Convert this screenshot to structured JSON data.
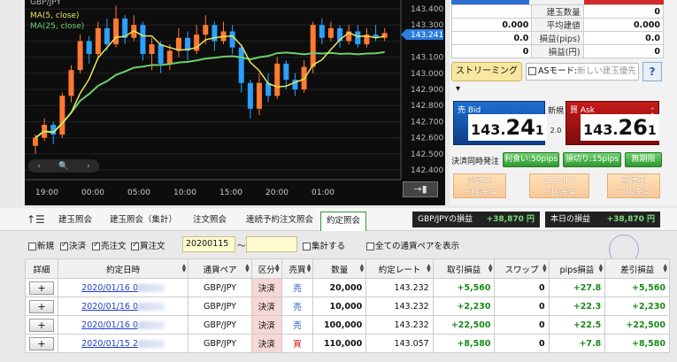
{
  "chart": {
    "title": "GBP/JPY",
    "legend": [
      "MA(5, close)",
      "MA(25, close)"
    ],
    "colors": {
      "up": "#ff7a30",
      "down": "#2aa0ff",
      "ma5": "#e6e65a",
      "ma25": "#6cd06c",
      "current": "#2a7de0"
    },
    "price_ticks": [
      "143.400",
      "143.300",
      "143.241",
      "143.100",
      "143.000",
      "142.900",
      "142.800",
      "142.700",
      "142.600",
      "142.500",
      "142.400"
    ],
    "time_ticks": [
      "19:00",
      "00:00",
      "05:00",
      "10:00",
      "15:00",
      "20:00",
      "01:00"
    ],
    "current_price": "143.241",
    "zoom_controls": [
      "‹",
      "🔍",
      "›"
    ],
    "jump_label": "→▮"
  },
  "position": {
    "rows": [
      {
        "left": "",
        "label": "建玉数量",
        "right": "0"
      },
      {
        "left": "0.000",
        "label": "平均建値",
        "right": "0.000"
      },
      {
        "left": "0.0",
        "label": "損益(pips)",
        "right": "0.0"
      },
      {
        "left": "0",
        "label": "損益(円)",
        "right": "0"
      }
    ]
  },
  "streaming": {
    "label": "ストリーミング ▾",
    "as_mode": "ASモード:",
    "as_placeholder": "新しい建玉優先",
    "help": "?"
  },
  "quote": {
    "bid_label": "売 Bid",
    "bid_small": "143.",
    "bid_big": "24",
    "bid_pip": "1",
    "ask_label": "買 Ask",
    "ask_small": "143.",
    "ask_big": "26",
    "ask_pip": "1",
    "spread_label": "新規",
    "spread_value": "2.0"
  },
  "settle": {
    "label": "決済同時発注",
    "buttons": [
      "利食い:50pips",
      "損切り:15pips",
      "無期限"
    ]
  },
  "bulk": [
    {
      "line1": "売建玉",
      "line2": "一括決済"
    },
    {
      "line1": "GBP/JPY",
      "line2": "一括決済"
    },
    {
      "line1": "買建玉",
      "line2": "一括決済"
    }
  ],
  "tabs": [
    "建玉照会",
    "建玉照会（集計）",
    "注文照会",
    "連続予約注文照会",
    "約定照会"
  ],
  "tab_menu_icon": "↑☰",
  "pl": [
    {
      "label": "GBP/JPYの損益",
      "value": "+38,870 円"
    },
    {
      "label": "本日の損益",
      "value": "+38,870 円"
    }
  ],
  "filter": {
    "checks": [
      {
        "label": "新規",
        "checked": false
      },
      {
        "label": "決済",
        "checked": true
      },
      {
        "label": "売注文",
        "checked": true
      },
      {
        "label": "買注文",
        "checked": true
      }
    ],
    "date_from": "20200115",
    "tilde": "〜",
    "date_to": "",
    "aggregate": "集計する",
    "all_pairs": "全ての通貨ペアを表示"
  },
  "table": {
    "headers": [
      "詳細",
      "約定日時",
      "通貨ペア",
      "区分",
      "売買",
      "数量",
      "約定レート",
      "取引損益",
      "スワップ",
      "pips損益",
      "差引損益"
    ],
    "rows": [
      {
        "btn": "+",
        "date": "2020/01/16 0",
        "pair": "GBP/JPY",
        "kbn": "決済",
        "side": "売",
        "qty": "20,000",
        "rate": "143.232",
        "pl": "+5,560",
        "swap": "0",
        "pips": "+27.8",
        "net": "+5,560"
      },
      {
        "btn": "+",
        "date": "2020/01/16 0",
        "pair": "GBP/JPY",
        "kbn": "決済",
        "side": "売",
        "qty": "10,000",
        "rate": "143.232",
        "pl": "+2,230",
        "swap": "0",
        "pips": "+22.3",
        "net": "+2,230"
      },
      {
        "btn": "+",
        "date": "2020/01/16 0",
        "pair": "GBP/JPY",
        "kbn": "決済",
        "side": "売",
        "qty": "100,000",
        "rate": "143.232",
        "pl": "+22,500",
        "swap": "0",
        "pips": "+22.5",
        "net": "+22,500"
      },
      {
        "btn": "+",
        "date": "2020/01/15 2",
        "pair": "GBP/JPY",
        "kbn": "決済",
        "side": "買",
        "qty": "110,000",
        "rate": "143.057",
        "pl": "+8,580",
        "swap": "0",
        "pips": "+7.8",
        "net": "+8,580"
      }
    ]
  }
}
